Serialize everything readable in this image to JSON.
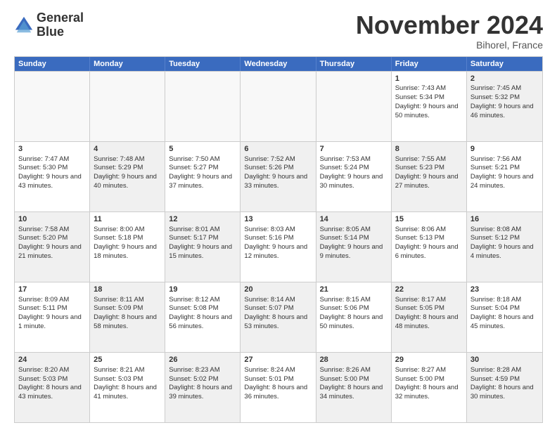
{
  "logo": {
    "line1": "General",
    "line2": "Blue"
  },
  "title": "November 2024",
  "subtitle": "Bihorel, France",
  "header_days": [
    "Sunday",
    "Monday",
    "Tuesday",
    "Wednesday",
    "Thursday",
    "Friday",
    "Saturday"
  ],
  "rows": [
    [
      {
        "day": "",
        "info": "",
        "shaded": false,
        "empty": true
      },
      {
        "day": "",
        "info": "",
        "shaded": false,
        "empty": true
      },
      {
        "day": "",
        "info": "",
        "shaded": false,
        "empty": true
      },
      {
        "day": "",
        "info": "",
        "shaded": false,
        "empty": true
      },
      {
        "day": "",
        "info": "",
        "shaded": false,
        "empty": true
      },
      {
        "day": "1",
        "info": "Sunrise: 7:43 AM\nSunset: 5:34 PM\nDaylight: 9 hours and 50 minutes.",
        "shaded": false,
        "empty": false
      },
      {
        "day": "2",
        "info": "Sunrise: 7:45 AM\nSunset: 5:32 PM\nDaylight: 9 hours and 46 minutes.",
        "shaded": true,
        "empty": false
      }
    ],
    [
      {
        "day": "3",
        "info": "Sunrise: 7:47 AM\nSunset: 5:30 PM\nDaylight: 9 hours and 43 minutes.",
        "shaded": false,
        "empty": false
      },
      {
        "day": "4",
        "info": "Sunrise: 7:48 AM\nSunset: 5:29 PM\nDaylight: 9 hours and 40 minutes.",
        "shaded": true,
        "empty": false
      },
      {
        "day": "5",
        "info": "Sunrise: 7:50 AM\nSunset: 5:27 PM\nDaylight: 9 hours and 37 minutes.",
        "shaded": false,
        "empty": false
      },
      {
        "day": "6",
        "info": "Sunrise: 7:52 AM\nSunset: 5:26 PM\nDaylight: 9 hours and 33 minutes.",
        "shaded": true,
        "empty": false
      },
      {
        "day": "7",
        "info": "Sunrise: 7:53 AM\nSunset: 5:24 PM\nDaylight: 9 hours and 30 minutes.",
        "shaded": false,
        "empty": false
      },
      {
        "day": "8",
        "info": "Sunrise: 7:55 AM\nSunset: 5:23 PM\nDaylight: 9 hours and 27 minutes.",
        "shaded": true,
        "empty": false
      },
      {
        "day": "9",
        "info": "Sunrise: 7:56 AM\nSunset: 5:21 PM\nDaylight: 9 hours and 24 minutes.",
        "shaded": false,
        "empty": false
      }
    ],
    [
      {
        "day": "10",
        "info": "Sunrise: 7:58 AM\nSunset: 5:20 PM\nDaylight: 9 hours and 21 minutes.",
        "shaded": true,
        "empty": false
      },
      {
        "day": "11",
        "info": "Sunrise: 8:00 AM\nSunset: 5:18 PM\nDaylight: 9 hours and 18 minutes.",
        "shaded": false,
        "empty": false
      },
      {
        "day": "12",
        "info": "Sunrise: 8:01 AM\nSunset: 5:17 PM\nDaylight: 9 hours and 15 minutes.",
        "shaded": true,
        "empty": false
      },
      {
        "day": "13",
        "info": "Sunrise: 8:03 AM\nSunset: 5:16 PM\nDaylight: 9 hours and 12 minutes.",
        "shaded": false,
        "empty": false
      },
      {
        "day": "14",
        "info": "Sunrise: 8:05 AM\nSunset: 5:14 PM\nDaylight: 9 hours and 9 minutes.",
        "shaded": true,
        "empty": false
      },
      {
        "day": "15",
        "info": "Sunrise: 8:06 AM\nSunset: 5:13 PM\nDaylight: 9 hours and 6 minutes.",
        "shaded": false,
        "empty": false
      },
      {
        "day": "16",
        "info": "Sunrise: 8:08 AM\nSunset: 5:12 PM\nDaylight: 9 hours and 4 minutes.",
        "shaded": true,
        "empty": false
      }
    ],
    [
      {
        "day": "17",
        "info": "Sunrise: 8:09 AM\nSunset: 5:11 PM\nDaylight: 9 hours and 1 minute.",
        "shaded": false,
        "empty": false
      },
      {
        "day": "18",
        "info": "Sunrise: 8:11 AM\nSunset: 5:09 PM\nDaylight: 8 hours and 58 minutes.",
        "shaded": true,
        "empty": false
      },
      {
        "day": "19",
        "info": "Sunrise: 8:12 AM\nSunset: 5:08 PM\nDaylight: 8 hours and 56 minutes.",
        "shaded": false,
        "empty": false
      },
      {
        "day": "20",
        "info": "Sunrise: 8:14 AM\nSunset: 5:07 PM\nDaylight: 8 hours and 53 minutes.",
        "shaded": true,
        "empty": false
      },
      {
        "day": "21",
        "info": "Sunrise: 8:15 AM\nSunset: 5:06 PM\nDaylight: 8 hours and 50 minutes.",
        "shaded": false,
        "empty": false
      },
      {
        "day": "22",
        "info": "Sunrise: 8:17 AM\nSunset: 5:05 PM\nDaylight: 8 hours and 48 minutes.",
        "shaded": true,
        "empty": false
      },
      {
        "day": "23",
        "info": "Sunrise: 8:18 AM\nSunset: 5:04 PM\nDaylight: 8 hours and 45 minutes.",
        "shaded": false,
        "empty": false
      }
    ],
    [
      {
        "day": "24",
        "info": "Sunrise: 8:20 AM\nSunset: 5:03 PM\nDaylight: 8 hours and 43 minutes.",
        "shaded": true,
        "empty": false
      },
      {
        "day": "25",
        "info": "Sunrise: 8:21 AM\nSunset: 5:03 PM\nDaylight: 8 hours and 41 minutes.",
        "shaded": false,
        "empty": false
      },
      {
        "day": "26",
        "info": "Sunrise: 8:23 AM\nSunset: 5:02 PM\nDaylight: 8 hours and 39 minutes.",
        "shaded": true,
        "empty": false
      },
      {
        "day": "27",
        "info": "Sunrise: 8:24 AM\nSunset: 5:01 PM\nDaylight: 8 hours and 36 minutes.",
        "shaded": false,
        "empty": false
      },
      {
        "day": "28",
        "info": "Sunrise: 8:26 AM\nSunset: 5:00 PM\nDaylight: 8 hours and 34 minutes.",
        "shaded": true,
        "empty": false
      },
      {
        "day": "29",
        "info": "Sunrise: 8:27 AM\nSunset: 5:00 PM\nDaylight: 8 hours and 32 minutes.",
        "shaded": false,
        "empty": false
      },
      {
        "day": "30",
        "info": "Sunrise: 8:28 AM\nSunset: 4:59 PM\nDaylight: 8 hours and 30 minutes.",
        "shaded": true,
        "empty": false
      }
    ]
  ]
}
